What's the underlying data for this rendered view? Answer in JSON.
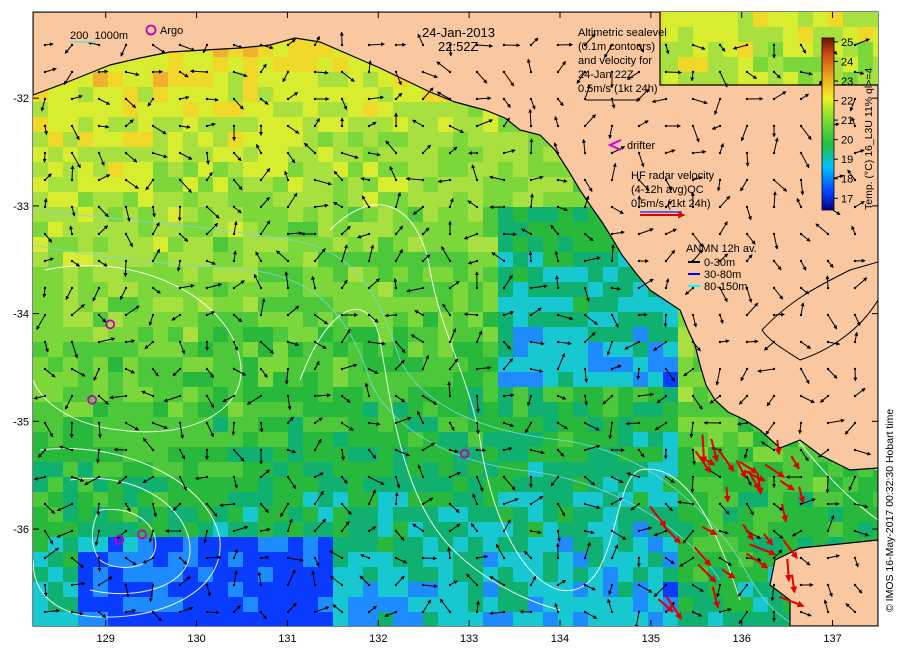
{
  "title": {
    "date": "24-Jan-2013",
    "time": "22:52Z"
  },
  "bathymetry_legend": {
    "depths": "200  1000m"
  },
  "argo_legend": {
    "label": "Argo"
  },
  "altimetry_note": {
    "lines": [
      "Altimetric sealevel",
      "(0.1m contours)",
      "and velocity for",
      "24-Jan 22Z",
      "0.5m/s (1kt 24h)"
    ]
  },
  "drifter_legend": {
    "label": "drifter"
  },
  "hf_radar_note": {
    "lines": [
      "HF radar velocity",
      "(4-12h avg)QC",
      "0.5m/s (1kt 24h)"
    ]
  },
  "anmn_legend": {
    "title": "ANMN 12h av.",
    "items": [
      {
        "label": "0-30m",
        "color": "#000000"
      },
      {
        "label": "30-80m",
        "color": "#0000ff"
      },
      {
        "label": "80-150m",
        "color": "#00ffff"
      }
    ]
  },
  "colorbar": {
    "label": "Temp. (°C) 16_L3U 11% ql>=4",
    "ticks": [
      "25",
      "24",
      "23",
      "22",
      "21",
      "20",
      "19",
      "18",
      "17"
    ],
    "min": 16.4,
    "max": 25.2
  },
  "credit": "© IMOS 16-May-2017 00:32:30 Hobart time",
  "axes": {
    "x_ticks": [
      "129",
      "130",
      "131",
      "132",
      "133",
      "134",
      "135",
      "136",
      "137"
    ],
    "y_ticks": [
      "-32",
      "-33",
      "-34",
      "-35",
      "-36"
    ],
    "x_range": [
      128.2,
      137.5
    ],
    "y_range": [
      -36.9,
      -31.2
    ]
  },
  "argo_floats": [
    {
      "lon": 129.05,
      "lat": -34.1
    },
    {
      "lon": 128.85,
      "lat": -34.8
    },
    {
      "lon": 132.95,
      "lat": -35.3
    },
    {
      "lon": 129.15,
      "lat": -36.1
    },
    {
      "lon": 129.4,
      "lat": -36.05
    }
  ],
  "colors": {
    "land": "#f9c8a0",
    "hf_radar_arrows": "#e00000",
    "sla_contours": "#ffffff",
    "bathy_200": "#7fd7d7",
    "argo_marker": "#c000c0"
  }
}
